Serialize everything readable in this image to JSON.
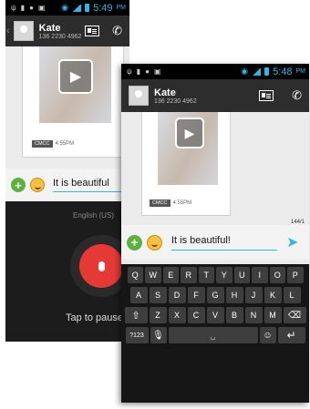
{
  "back": {
    "status": {
      "icons": [
        "usb-icon",
        "sd-card-icon",
        "voicemail-icon",
        "image-icon"
      ],
      "time": "5:49",
      "ampm": "PM"
    },
    "contact": {
      "name": "Kate",
      "number": "136 2230 4962"
    },
    "message": {
      "carrier": "CMCC",
      "time": "4:55PM"
    },
    "compose": {
      "text": "It is beautiful"
    },
    "voice": {
      "language": "English (US)",
      "hint": "Tap to pause"
    }
  },
  "front": {
    "status": {
      "time": "5:48",
      "ampm": "PM"
    },
    "contact": {
      "name": "Kate",
      "number": "136 2230 4962"
    },
    "message": {
      "carrier": "CMCC",
      "time": "4:55PM"
    },
    "compose": {
      "text": "It is beautiful!",
      "counter": "144/1"
    },
    "keyboard": {
      "row1": [
        "Q",
        "W",
        "E",
        "R",
        "T",
        "Y",
        "U",
        "I",
        "O",
        "P"
      ],
      "row2": [
        "A",
        "S",
        "D",
        "F",
        "G",
        "H",
        "J",
        "K",
        "L"
      ],
      "row3": [
        "Z",
        "X",
        "C",
        "V",
        "B",
        "N",
        "M"
      ],
      "symbols": "?123"
    }
  },
  "colors": {
    "accent": "#33b5e5",
    "mic": "#e53935",
    "plus": "#5bb33c"
  }
}
